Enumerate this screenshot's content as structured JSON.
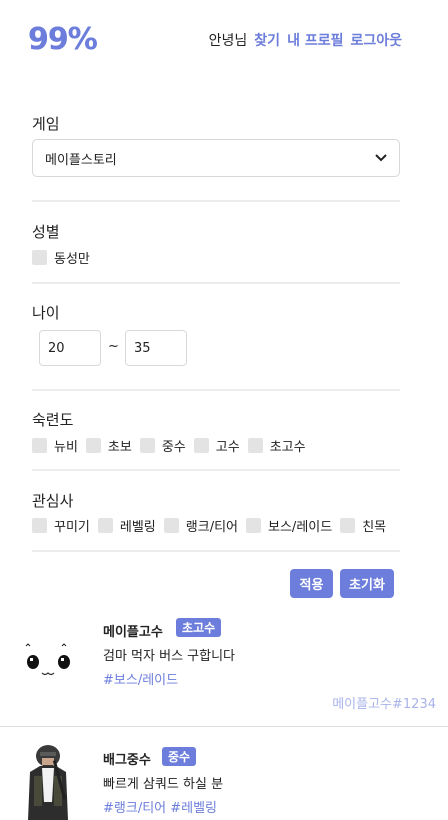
{
  "header": {
    "logo": "99%",
    "greeting": "안녕님",
    "nav": [
      "찾기",
      "내 프로필",
      "로그아웃"
    ]
  },
  "filters": {
    "game": {
      "title": "게임",
      "selected": "메이플스토리"
    },
    "gender": {
      "title": "성별",
      "options": [
        "동성만"
      ]
    },
    "age": {
      "title": "나이",
      "min": "20",
      "separator": "~",
      "max": "35"
    },
    "skill": {
      "title": "숙련도",
      "options": [
        "뉴비",
        "초보",
        "중수",
        "고수",
        "초고수"
      ]
    },
    "interests": {
      "title": "관심사",
      "options": [
        "꾸미기",
        "레벨링",
        "랭크/티어",
        "보스/레이드",
        "친목"
      ]
    }
  },
  "actions": {
    "apply": "적용",
    "reset": "초기화"
  },
  "results": [
    {
      "name": "메이플고수",
      "level": "초고수",
      "desc": "검마 먹자 버스 구합니다",
      "tags": "#보스/레이드",
      "id": "메이플고수#1234",
      "avatar": "slime-face"
    },
    {
      "name": "배그중수",
      "level": "중수",
      "desc": "빠르게 삼쿼드 하실 분",
      "tags": "#랭크/티어 #레벨링",
      "id": "",
      "avatar": "soldier"
    }
  ],
  "colors": {
    "accent": "#6c7ddb",
    "accent_light": "#a9b3ea"
  }
}
